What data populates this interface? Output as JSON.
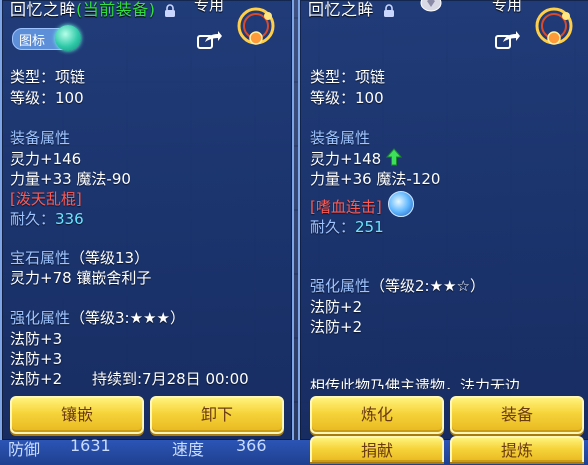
{
  "left": {
    "title": "回忆之眸",
    "equipped_tag": "(当前装备)",
    "exclusive": "专用",
    "icon_toggle": "图标",
    "type": "类型：项链",
    "level": "等级：100",
    "attr_head": "装备属性",
    "attr_lines": [
      "灵力+146",
      "力量+33 魔法-90"
    ],
    "special": "[泼天乱棍]",
    "durability_label": "耐久：",
    "durability_value": "336",
    "gem_head": "宝石属性",
    "gem_level": "（等级13）",
    "gem_line": "灵力+78 镶嵌舍利子",
    "enh_head": "强化属性",
    "enh_level": "（等级3:★★★）",
    "enh_lines": [
      "法防+3",
      "法防+3",
      "法防+2"
    ],
    "duration": "持续到:7月28日 00:00",
    "buttons": [
      "镶嵌",
      "卸下"
    ]
  },
  "right": {
    "title": "回忆之眸",
    "exclusive": "专用",
    "type": "类型：项链",
    "level": "等级：100",
    "attr_head": "装备属性",
    "attr_lines": [
      "灵力+148",
      "力量+36 魔法-120"
    ],
    "special": "[嗜血连击]",
    "durability_label": "耐久：",
    "durability_value": "251",
    "enh_head": "强化属性",
    "enh_level": "（等级2:★★☆）",
    "enh_lines": [
      "法防+2",
      "法防+2"
    ],
    "description": "相传此物乃佛主遗物，法力无边",
    "buttons": [
      "炼化",
      "装备",
      "捐献",
      "提炼"
    ]
  },
  "bottom": {
    "left_label": "防御",
    "left_value": "1631",
    "right_label": "速度",
    "right_value": "366"
  },
  "colors": {
    "heading": "#9fc4ff",
    "special": "#ff5a52",
    "durability": "#67e6ff",
    "equipped": "#33e040",
    "button": "#f6d33a"
  },
  "icons": [
    "lock-icon",
    "share-icon",
    "necklace-item-icon",
    "gem-badge-icon",
    "up-arrow-icon",
    "skill-orb-icon"
  ]
}
